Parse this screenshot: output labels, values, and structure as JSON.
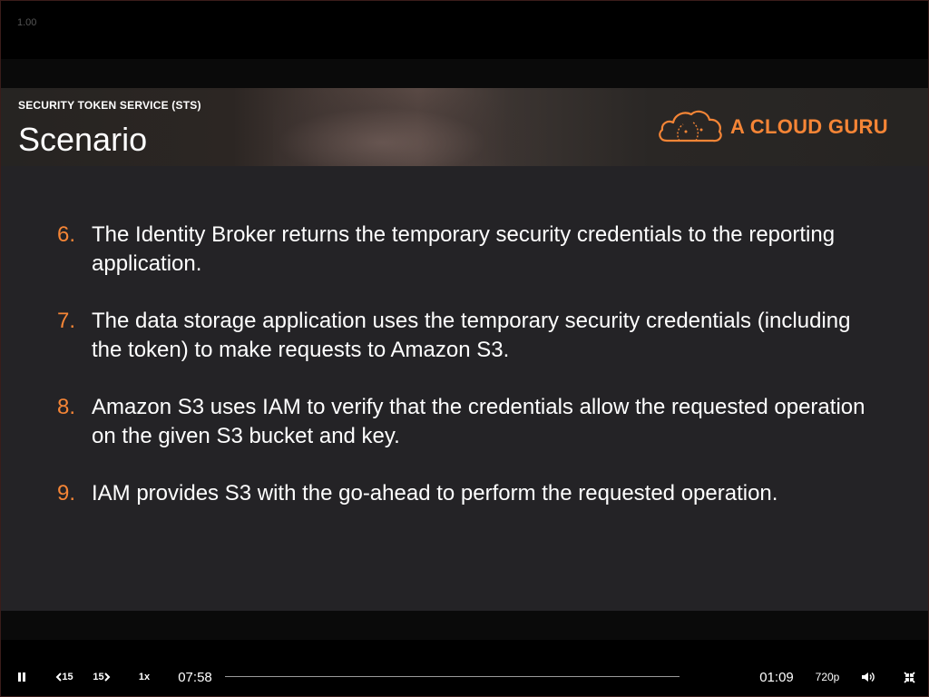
{
  "player": {
    "zoom_label": "1.00",
    "current_time": "07:58",
    "remaining_time": "01:09",
    "progress_fraction": 0.0,
    "playback_rate": "1x",
    "quality": "720p",
    "skip_back_label": "15",
    "skip_forward_label": "15"
  },
  "slide": {
    "section_label": "SECURITY TOKEN SERVICE (STS)",
    "title": "Scenario",
    "logo_text": "A CLOUD GURU",
    "items": [
      {
        "num": "6.",
        "text": "The Identity Broker returns the temporary security credentials to the reporting application."
      },
      {
        "num": "7.",
        "text": "The data storage application uses the temporary security credentials (including the token) to make requests to Amazon S3."
      },
      {
        "num": "8.",
        "text": "Amazon S3 uses IAM to verify that the credentials allow the requested operation on the given S3 bucket and key."
      },
      {
        "num": "9.",
        "text": "IAM provides S3 with the go-ahead to perform the requested operation."
      }
    ]
  },
  "icons": {
    "pause": "pause-icon",
    "skip_back": "skip-back-icon",
    "skip_forward": "skip-forward-icon",
    "volume": "volume-icon",
    "exit_fullscreen": "exit-fullscreen-icon",
    "logo": "cloud-logo-icon"
  },
  "colors": {
    "accent": "#f58536",
    "slide_bg": "#242326",
    "text": "#ffffff"
  }
}
